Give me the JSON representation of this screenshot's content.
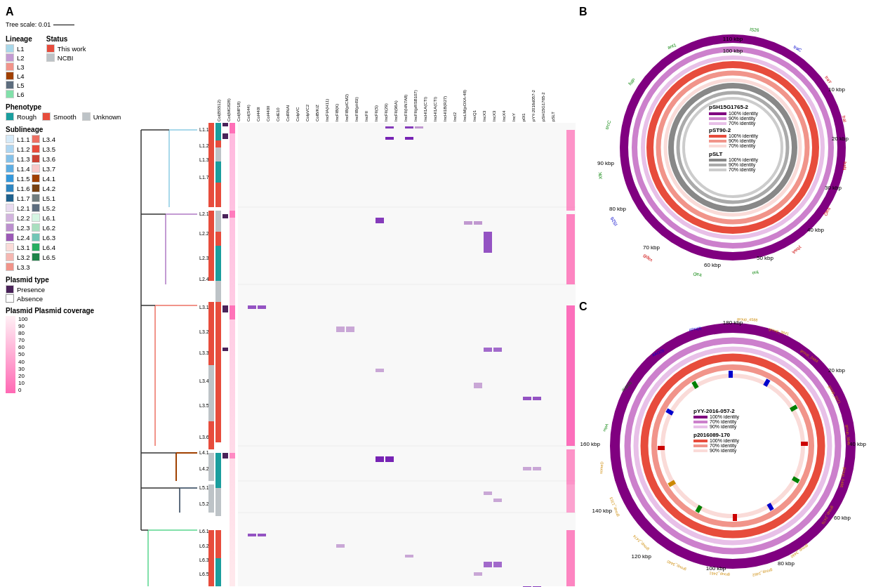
{
  "panel_labels": {
    "a": "A",
    "b": "B",
    "c": "C"
  },
  "legend": {
    "tree_scale_label": "Tree scale: 0.01",
    "lineage_title": "Lineage",
    "status_title": "Status",
    "lineages": [
      {
        "label": "L1",
        "color": "#a8d8ea"
      },
      {
        "label": "L2",
        "color": "#c39bd3"
      },
      {
        "label": "L3",
        "color": "#f1948a"
      },
      {
        "label": "L4",
        "color": "#a04000"
      },
      {
        "label": "L5",
        "color": "#5d6d7e"
      },
      {
        "label": "L6",
        "color": "#82e0aa"
      }
    ],
    "status_items": [
      {
        "label": "This work",
        "color": "#e74c3c"
      },
      {
        "label": "NCBI",
        "color": "#bdc3c7"
      }
    ],
    "phenotype_title": "Phenotype",
    "phenotype_items": [
      {
        "label": "Rough",
        "color": "#1a9e9e"
      },
      {
        "label": "Smooth",
        "color": "#e74c3c"
      },
      {
        "label": "Unknown",
        "color": "#bdc3c7"
      }
    ],
    "sublineage_title": "Sublineage",
    "sublineages": [
      "L1.1",
      "L1.2",
      "L1.3",
      "L1.4",
      "L1.5",
      "L1.6",
      "L1.7",
      "L2.1",
      "L2.2",
      "L2.3",
      "L2.4",
      "L3.1",
      "L3.2",
      "L3.3",
      "L3.4",
      "L3.5",
      "L3.6",
      "L3.7",
      "L4.1",
      "L4.2",
      "L5.1",
      "L5.2",
      "L6.1",
      "L6.2",
      "L6.3",
      "L6.4",
      "L6.5"
    ],
    "plasmid_type_title": "Plasmid type",
    "plasmid_items": [
      {
        "label": "Presence",
        "color": "#4a235a"
      },
      {
        "label": "Absence",
        "color": "#ffffff"
      }
    ],
    "plasmid_coverage_title": "Plasmid coverage",
    "coverage_values": [
      "0",
      "10",
      "20",
      "30",
      "40",
      "50",
      "60",
      "70",
      "80",
      "90",
      "100"
    ]
  },
  "columns": [
    "Col(BS512)",
    "Col(MG828)",
    "Col(MP18)",
    "Col(S44)",
    "Col440I",
    "Col440II",
    "ColE10",
    "ColRNAI",
    "ColpVC",
    "ColpVC2",
    "ColB/K/Z",
    "IncFIA(H11)",
    "IncFIB(K)",
    "IncFIB(pICM2)",
    "IncFIB(pHSI)",
    "IncFII",
    "IncFII(S)",
    "IncFII(29)",
    "IncFII(96A)",
    "IncFII(HN7A8)",
    "IncFII(pRSB107)",
    "IncHI1A(CTI)",
    "IncHI1A(CTI)",
    "IncHI1B(R27)",
    "IncI2",
    "IncLM(pOXA-48)",
    "IncQ1",
    "IncX3",
    "IncX3",
    "IncX4",
    "IncY",
    "p0I1",
    "pYY-2016d057-2",
    "pSH15G1765-2",
    "pSLT"
  ],
  "panel_b": {
    "title": "pSH15G1765-2",
    "circle_labels": [
      "110 kbp",
      "100 kbp",
      "90 kbp",
      "80 kbp",
      "70 kbp",
      "60 kbp",
      "50 kbp",
      "40 kbp",
      "30 kbp",
      "20 kbp",
      "10 kbp"
    ],
    "legend_items": [
      {
        "name": "pSH15G1765-2",
        "items": [
          {
            "label": "100% identity",
            "color": "#800080"
          },
          {
            "label": "90% identity",
            "color": "#cc80cc"
          },
          {
            "label": "70% identity",
            "color": "#e8c0e8"
          }
        ]
      },
      {
        "name": "pST90-2",
        "items": [
          {
            "label": "100% identity",
            "color": "#e74c3c"
          },
          {
            "label": "90% identity",
            "color": "#f1948a"
          },
          {
            "label": "70% identity",
            "color": "#fadbd8"
          }
        ]
      },
      {
        "name": "pSLT",
        "items": [
          {
            "label": "100% identity",
            "color": "#888"
          },
          {
            "label": "90% identity",
            "color": "#aaa"
          },
          {
            "label": "70% identity",
            "color": "#ccc"
          }
        ]
      }
    ]
  },
  "panel_c": {
    "title": "pYY-2016-057-2",
    "circle_labels": [
      "180 kbp",
      "160 kbp",
      "140 kbp",
      "120 kbp",
      "100 kbp",
      "80 kbp",
      "60 kbp",
      "40 kbp",
      "20 kbp"
    ],
    "legend_items": [
      {
        "name": "pYY-2016-057-2",
        "items": [
          {
            "label": "100% identity",
            "color": "#800080"
          },
          {
            "label": "70% identity",
            "color": "#cc80cc"
          },
          {
            "label": "90% identity",
            "color": "#e8c0e8"
          }
        ]
      },
      {
        "name": "p2016089-170",
        "items": [
          {
            "label": "100% identity",
            "color": "#e74c3c"
          },
          {
            "label": "70% identity",
            "color": "#f1948a"
          },
          {
            "label": "90% identity",
            "color": "#fadbd8"
          }
        ]
      }
    ]
  }
}
